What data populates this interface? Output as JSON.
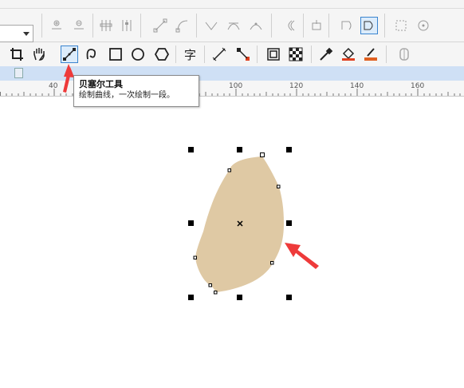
{
  "ruler": {
    "labels": [
      "40",
      "100",
      "120",
      "140",
      "160"
    ]
  },
  "tooltip": {
    "title": "贝塞尔工具",
    "description": "绘制曲线，一次绘制一段。"
  },
  "toolbar1": {
    "icons": [
      "node-add-icon",
      "node-delete-icon",
      "join-nodes-icon",
      "break-curve-icon",
      "to-line-icon",
      "to-curve-icon",
      "cusp-node-icon",
      "smooth-node-icon",
      "symmetrical-node-icon",
      "reverse-direction-icon",
      "extract-subpath-icon",
      "close-curve-icon",
      "elastic-mode-icon",
      "rotate-nodes-icon"
    ]
  },
  "toolbar2": {
    "icons": [
      "crop-tool-icon",
      "pan-tool-icon",
      "bezier-tool-icon",
      "artistic-media-icon",
      "rectangle-tool-icon",
      "ellipse-tool-icon",
      "polygon-tool-icon",
      "text-tool-icon",
      "parallel-dimension-icon",
      "connector-tool-icon",
      "drop-shadow-icon",
      "transparency-icon",
      "eyedropper-icon",
      "interactive-fill-icon",
      "smart-fill-icon",
      "outline-pen-icon"
    ]
  },
  "shape": {
    "fill_color": "#dfc9a4",
    "annotation_color": "#ee3a3a"
  }
}
